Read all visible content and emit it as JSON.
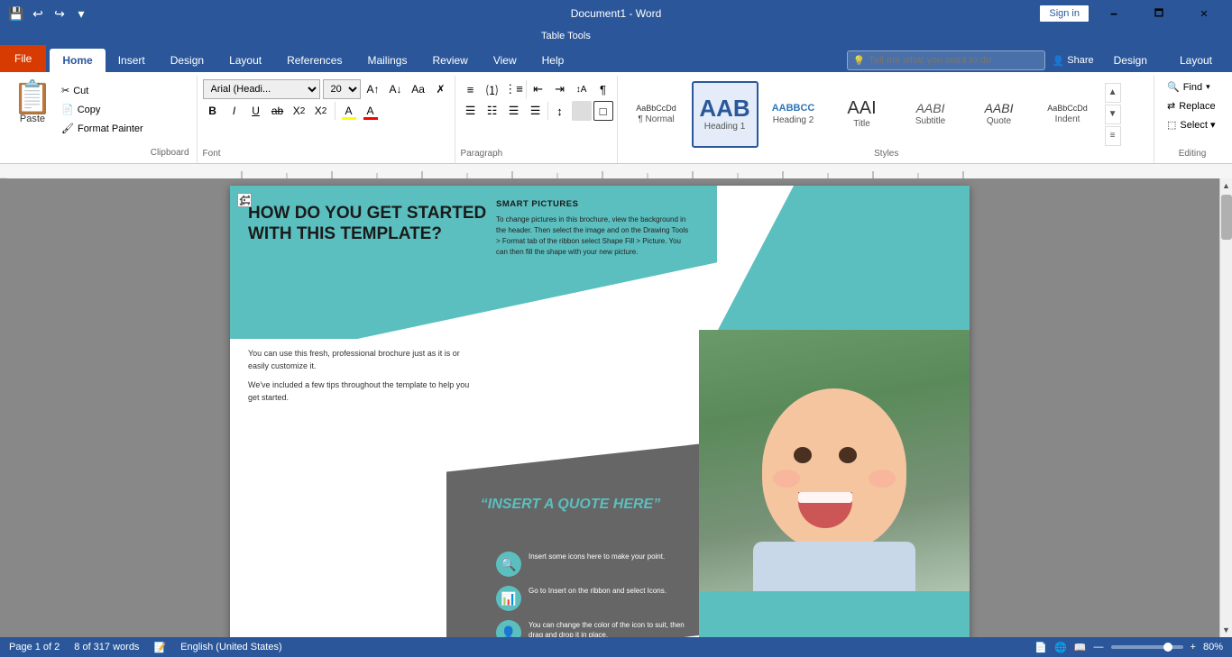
{
  "titlebar": {
    "title": "Document1 - Word",
    "save_icon": "💾",
    "undo_icon": "↩",
    "redo_icon": "↪",
    "dropdown_icon": "▾",
    "minimize": "🗕",
    "maximize": "🗖",
    "close": "✕",
    "signin": "Sign in"
  },
  "tabs": [
    {
      "id": "file",
      "label": "File",
      "active": false
    },
    {
      "id": "home",
      "label": "Home",
      "active": true
    },
    {
      "id": "insert",
      "label": "Insert",
      "active": false
    },
    {
      "id": "design",
      "label": "Design",
      "active": false
    },
    {
      "id": "layout",
      "label": "Layout",
      "active": false
    },
    {
      "id": "references",
      "label": "References",
      "active": false
    },
    {
      "id": "mailings",
      "label": "Mailings",
      "active": false
    },
    {
      "id": "review",
      "label": "Review",
      "active": false
    },
    {
      "id": "view",
      "label": "View",
      "active": false
    },
    {
      "id": "help",
      "label": "Help",
      "active": false
    },
    {
      "id": "table-design",
      "label": "Design",
      "active": false
    },
    {
      "id": "table-layout",
      "label": "Layout",
      "active": false
    }
  ],
  "tabletools": {
    "label": "Table Tools"
  },
  "clipboard": {
    "group_label": "Clipboard",
    "paste_label": "Paste",
    "cut_label": "Cut",
    "copy_label": "Copy",
    "format_painter_label": "Format Painter"
  },
  "font": {
    "group_label": "Font",
    "font_name": "Arial (Headi...",
    "font_size": "20",
    "bold": "B",
    "italic": "I",
    "underline": "U",
    "strikethrough": "ab̶c",
    "subscript": "X₂",
    "superscript": "X²",
    "grow": "A↑",
    "shrink": "A↓",
    "case": "Aa",
    "clear": "✗",
    "highlight": "A",
    "color": "A"
  },
  "paragraph": {
    "group_label": "Paragraph",
    "bullets_label": "≡",
    "numbering_label": "≡",
    "indent_decrease": "⇤",
    "indent_increase": "⇥",
    "sort": "↕A",
    "show_marks": "¶",
    "align_left": "☰",
    "align_center": "☰",
    "align_right": "☰",
    "justify": "☰",
    "line_spacing": "↕",
    "shading": "☐",
    "borders": "□"
  },
  "styles": {
    "group_label": "Styles",
    "items": [
      {
        "id": "normal",
        "preview": "AaBbCcDd",
        "label": "¶ Normal",
        "active": false,
        "preview_size": 9
      },
      {
        "id": "heading1",
        "preview": "AAB",
        "label": "Heading 1",
        "active": true,
        "preview_size": 22
      },
      {
        "id": "heading2",
        "preview": "AABBCC",
        "label": "Heading 2",
        "active": false,
        "preview_size": 9
      },
      {
        "id": "title",
        "preview": "AAI",
        "label": "Title",
        "active": false,
        "preview_size": 16
      },
      {
        "id": "subtitle",
        "preview": "AABI",
        "label": "Subtitle",
        "active": false,
        "preview_size": 13
      },
      {
        "id": "quote",
        "preview": "AABI",
        "label": "Quote",
        "active": false,
        "preview_size": 13
      },
      {
        "id": "indent",
        "preview": "AaBbCcDd",
        "label": "Indent",
        "active": false,
        "preview_size": 9
      }
    ]
  },
  "editing": {
    "group_label": "Editing",
    "find_label": "Find",
    "replace_label": "Replace",
    "select_label": "Select ▾"
  },
  "tellme": {
    "placeholder": "Tell me what you want to do"
  },
  "share": {
    "label": "Share",
    "icon": "👤"
  },
  "document": {
    "heading": "HOW DO YOU GET STARTED WITH THIS TEMPLATE?",
    "body1": "You can use this fresh, professional brochure just as it is or easily customize it.",
    "body2": "We've included a few tips throughout the template to help you get started.",
    "smart_pictures_title": "SMART PICTURES",
    "smart_pictures_text": "To change pictures in this brochure, view the background in the header. Then select the image and on the Drawing Tools > Format tab of the ribbon select Shape Fill > Picture. You can then fill the shape with your new picture.",
    "quote": "“INSERT A QUOTE HERE”",
    "icon1_text": "Insert some icons here to make your point.",
    "icon2_text": "Go to Insert on the ribbon and select Icons.",
    "icon3_text": "You can change the color of the icon to suit, then drag and drop it in place.",
    "search_icon": "🔍",
    "chart_icon": "📊",
    "person_icon": "👤"
  },
  "statusbar": {
    "page_info": "Page 1 of 2",
    "words": "8 of 317 words",
    "language": "English (United States)",
    "zoom": "80%",
    "zoom_percent": "80%"
  }
}
